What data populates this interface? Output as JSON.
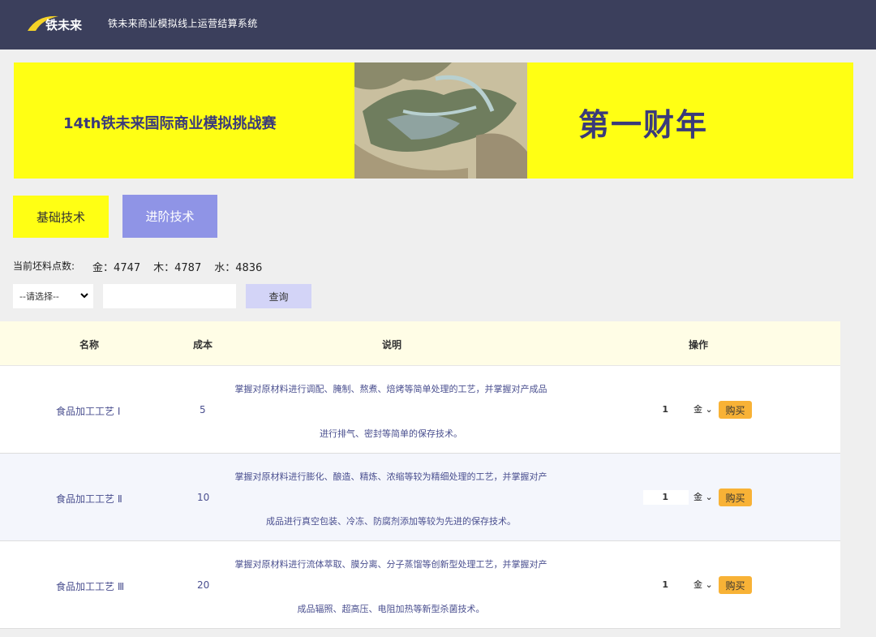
{
  "app": {
    "title": "铁未来商业模拟线上运营结算系统",
    "logo_text": "铁未来"
  },
  "banner": {
    "left_text": "14th铁未来国际商业模拟挑战赛",
    "right_text": "第一财年",
    "bg_color": "#ffff14"
  },
  "tabs": [
    {
      "label": "基础技术",
      "active": true
    },
    {
      "label": "进阶技术",
      "active": false
    }
  ],
  "points": {
    "label": "当前坯料点数:",
    "gold": "金：4747",
    "wood": "木：4787",
    "water": "水：4836"
  },
  "filter": {
    "select_value": "--请选择--",
    "input_value": "",
    "query_label": "查询"
  },
  "table": {
    "headers": {
      "name": "名称",
      "cost": "成本",
      "desc": "说明",
      "action": "操作"
    },
    "rows": [
      {
        "name": "食品加工工艺 Ⅰ",
        "cost": "5",
        "desc_line1": "掌握对原材料进行调配、腌制、熬煮、焙烤等简单处理的工艺，并掌握对产成品",
        "desc_line2": "进行排气、密封等简单的保存技术。",
        "qty": "1",
        "resource": "金",
        "buy": "购买"
      },
      {
        "name": "食品加工工艺 Ⅱ",
        "cost": "10",
        "desc_line1": "掌握对原材料进行膨化、酿造、精炼、浓缩等较为精细处理的工艺，并掌握对产",
        "desc_line2": "成品进行真空包装、冷冻、防腐剂添加等较为先进的保存技术。",
        "qty": "1",
        "resource": "金",
        "buy": "购买"
      },
      {
        "name": "食品加工工艺 Ⅲ",
        "cost": "20",
        "desc_line1": "掌握对原材料进行流体萃取、膜分离、分子蒸馏等创新型处理工艺，并掌握对产",
        "desc_line2": "成品辐照、超高压、电阻加热等新型杀菌技术。",
        "qty": "1",
        "resource": "金",
        "buy": "购买"
      }
    ]
  }
}
